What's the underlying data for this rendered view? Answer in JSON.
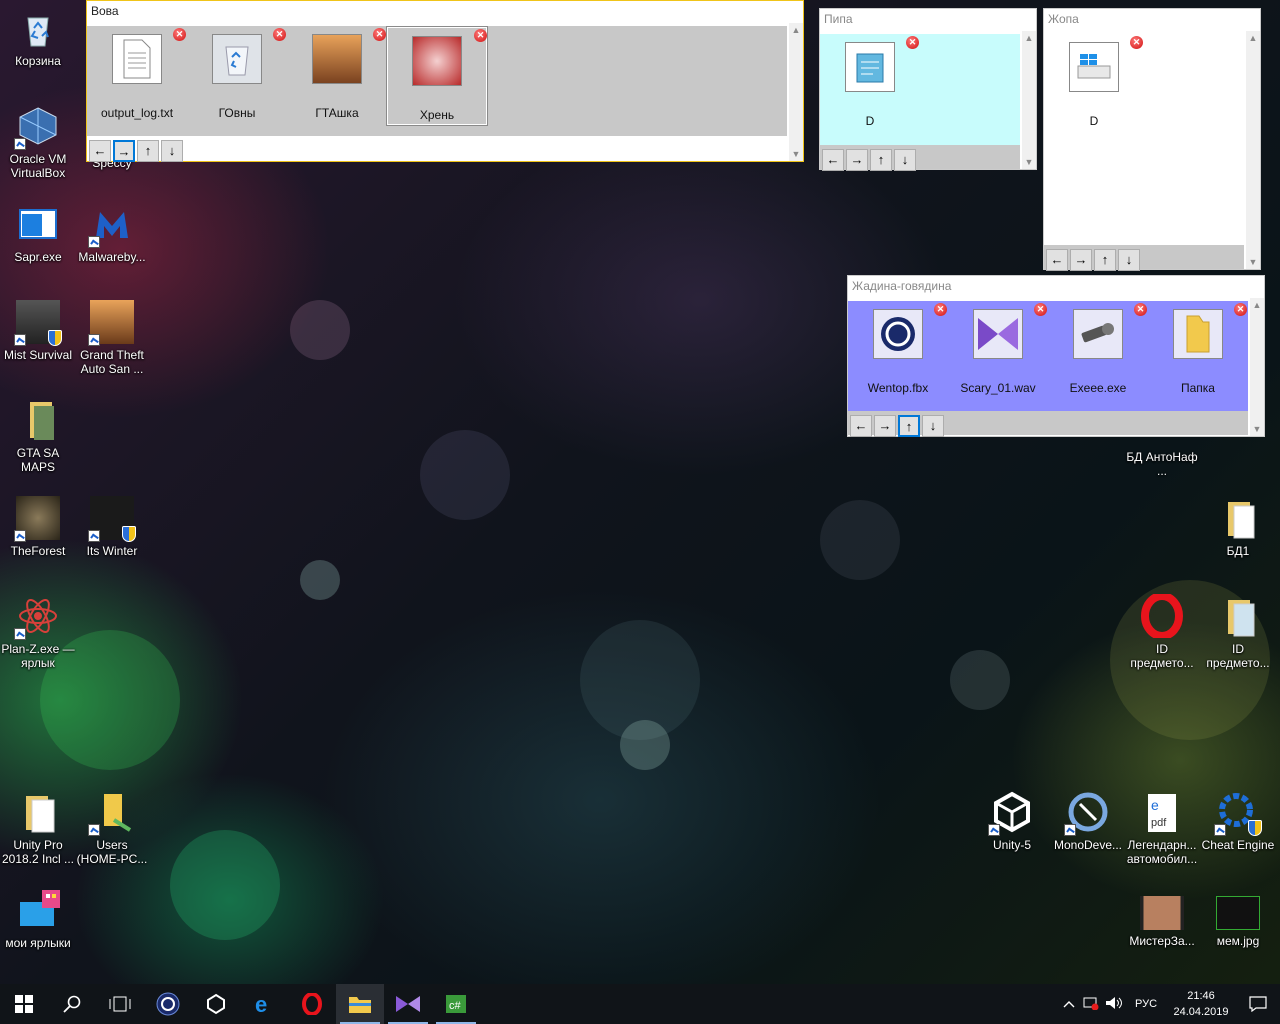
{
  "desktop": {
    "icons": [
      {
        "label": "Корзина",
        "icon": "recycle-bin-icon"
      },
      {
        "label": "Oracle VM VirtualBox",
        "icon": "virtualbox-icon"
      },
      {
        "label": "Speccy",
        "icon": "speccy-icon"
      },
      {
        "label": "Sapr.exe",
        "icon": "app-window-icon"
      },
      {
        "label": "Malwareby...",
        "icon": "malwarebytes-icon"
      },
      {
        "label": "Mist Survival",
        "icon": "game-icon"
      },
      {
        "label": "Grand Theft Auto San ...",
        "icon": "gta-icon"
      },
      {
        "label": "GTA SA MAPS",
        "icon": "folder-icon"
      },
      {
        "label": "TheForest",
        "icon": "game-icon"
      },
      {
        "label": "Its Winter",
        "icon": "game-icon"
      },
      {
        "label": "Plan-Z.exe — ярлык",
        "icon": "atom-icon"
      },
      {
        "label": "Unity Pro 2018.2 Incl ...",
        "icon": "folder-icon"
      },
      {
        "label": "Users (HOME-PC...",
        "icon": "folder-icon"
      },
      {
        "label": "мои ярлыки",
        "icon": "shortcuts-icon"
      },
      {
        "label": "БД АнтоНаф ...",
        "icon": "file-icon"
      },
      {
        "label": "БД1",
        "icon": "folder-icon"
      },
      {
        "label": "ID предмето...",
        "icon": "opera-icon"
      },
      {
        "label": "ID предмето...",
        "icon": "folder-icon"
      },
      {
        "label": "Unity-5",
        "icon": "unity-icon"
      },
      {
        "label": "MonoDeve...",
        "icon": "monodevelop-icon"
      },
      {
        "label": "Легендарн... автомобил...",
        "icon": "pdf-icon"
      },
      {
        "label": "Cheat Engine",
        "icon": "cheat-engine-icon"
      },
      {
        "label": "МистерЗа...",
        "icon": "video-icon"
      },
      {
        "label": "мем.jpg",
        "icon": "image-icon"
      }
    ]
  },
  "panels": {
    "vova": {
      "title": "Вова",
      "bg": "#c8c8c8",
      "items": [
        {
          "name": "output_log.txt",
          "icon": "text-file-icon"
        },
        {
          "name": "ГОвны",
          "icon": "recycle-bin-icon"
        },
        {
          "name": "ГТАшка",
          "icon": "gta-icon"
        },
        {
          "name": "Хрень",
          "icon": "red-image-icon"
        }
      ]
    },
    "pipa": {
      "title": "Пипа",
      "bg": "#c8fcfc",
      "items": [
        {
          "name": "D",
          "icon": "notepad-icon"
        }
      ]
    },
    "zhopa": {
      "title": "Жопа",
      "bg": "#ffffff",
      "items": [
        {
          "name": "D",
          "icon": "drive-icon"
        }
      ]
    },
    "zhadina": {
      "title": "Жадина-говядина",
      "bg": "#8c8cff",
      "items": [
        {
          "name": "Wentop.fbx",
          "icon": "cinema4d-icon"
        },
        {
          "name": "Scary_01.wav",
          "icon": "media-player-icon"
        },
        {
          "name": "Exeee.exe",
          "icon": "key-icon"
        },
        {
          "name": "Папка",
          "icon": "folder-icon"
        }
      ]
    },
    "nav": {
      "left": "←",
      "right": "→",
      "up": "↑",
      "down": "↓"
    },
    "delete_glyph": "✕"
  },
  "taskbar": {
    "apps": [
      "windows-start-icon",
      "search-icon",
      "task-view-icon",
      "cinema4d-icon",
      "unity-icon",
      "edge-icon",
      "opera-icon",
      "file-explorer-icon",
      "visual-studio-icon",
      "csharp-app-icon"
    ],
    "language": "РУС",
    "time": "21:46",
    "date": "24.04.2019"
  }
}
